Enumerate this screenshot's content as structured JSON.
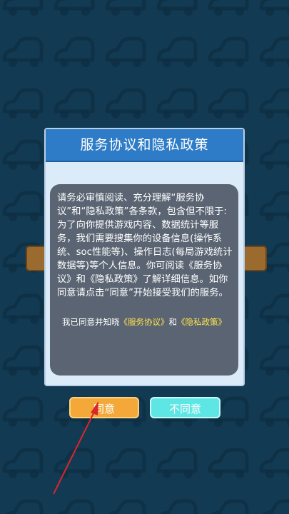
{
  "dialog": {
    "title": "服务协议和隐私政策",
    "body": "请务必审慎阅读、充分理解“服务协议”和“隐私政策”各条款，包含但不限于:为了向你提供游戏内容、数据统计等服务，我们需要搜集你的设备信息(操作系统、soc性能等)、操作日志(每局游戏统计数据等)等个人信息。你可阅读《服务协议》和《隐私政策》了解详细信息。如你同意请点击“同意”开始接受我们的服务。",
    "agree_prefix": "我已同意并知晓",
    "service_link": "《服务协议》",
    "and_text": "和",
    "privacy_link": "《隐私政策》"
  },
  "buttons": {
    "agree": "同意",
    "disagree": "不同意"
  },
  "colors": {
    "background": "#123a53",
    "header": "#2e7cc7",
    "link": "#ffe34d",
    "agree_button": "#f4a83a",
    "disagree_button": "#5ee6e4",
    "annotation_arrow": "#d9262c"
  },
  "icons": [
    "car-pattern-icon",
    "annotation-arrow-icon"
  ]
}
